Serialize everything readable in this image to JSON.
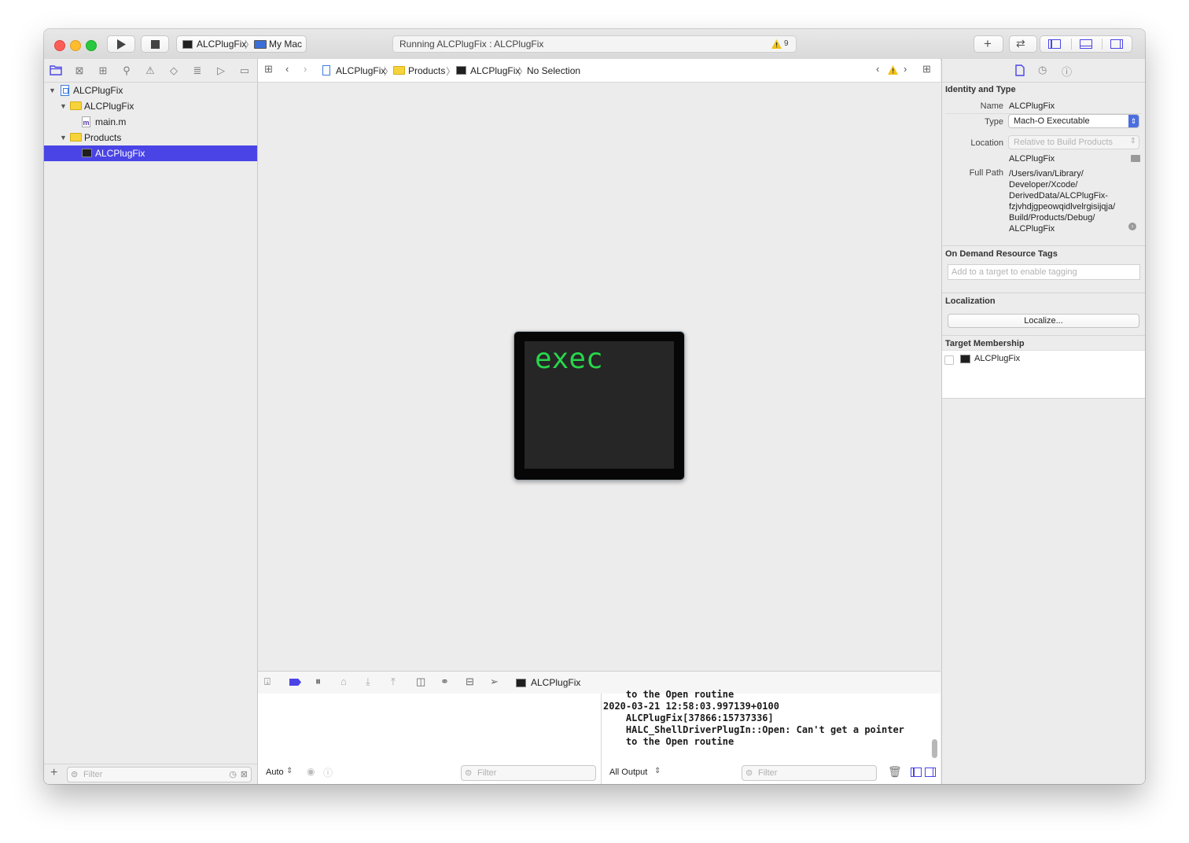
{
  "toolbar": {
    "scheme_target": "ALCPlugFix",
    "scheme_destination": "My Mac",
    "activity_status": "Running ALCPlugFix : ALCPlugFix",
    "warning_count": "9"
  },
  "navigator": {
    "tree": [
      {
        "label": "ALCPlugFix",
        "type": "project"
      },
      {
        "label": "ALCPlugFix",
        "type": "group"
      },
      {
        "label": "main.m",
        "type": "file"
      },
      {
        "label": "Products",
        "type": "group"
      },
      {
        "label": "ALCPlugFix",
        "type": "executable",
        "selected": true
      }
    ],
    "filter_placeholder": "Filter"
  },
  "jumpbar": {
    "path": [
      "ALCPlugFix",
      "Products",
      "ALCPlugFix",
      "No Selection"
    ]
  },
  "editor": {
    "preview_text": "exec"
  },
  "debug": {
    "process": "ALCPlugFix",
    "console_lines": [
      "    to the Open routine",
      "2020-03-21 12:58:03.997139+0100",
      "    ALCPlugFix[37866:15737336]",
      "    HALC_ShellDriverPlugIn::Open: Can't get a pointer",
      "    to the Open routine"
    ],
    "variables_mode": "Auto",
    "variables_filter_placeholder": "Filter",
    "output_mode": "All Output",
    "console_filter_placeholder": "Filter"
  },
  "inspector": {
    "identity_header": "Identity and Type",
    "name_label": "Name",
    "name_value": "ALCPlugFix",
    "type_label": "Type",
    "type_value": "Mach-O Executable",
    "location_label": "Location",
    "location_value": "Relative to Build Products",
    "file_name": "ALCPlugFix",
    "full_path_label": "Full Path",
    "full_path_lines": [
      "/Users/ivan/Library/",
      "Developer/Xcode/",
      "DerivedData/ALCPlugFix-",
      "fzjvhdjgpeowqidlvelrgisijqja/",
      "Build/Products/Debug/",
      "ALCPlugFix"
    ],
    "odr_header": "On Demand Resource Tags",
    "odr_placeholder": "Add to a target to enable tagging",
    "localization_header": "Localization",
    "localize_button": "Localize...",
    "membership_header": "Target Membership",
    "membership_target": "ALCPlugFix"
  },
  "colors": {
    "accent": "#4a44e6",
    "exec_green": "#27d64b",
    "warning": "#f2c21b"
  }
}
